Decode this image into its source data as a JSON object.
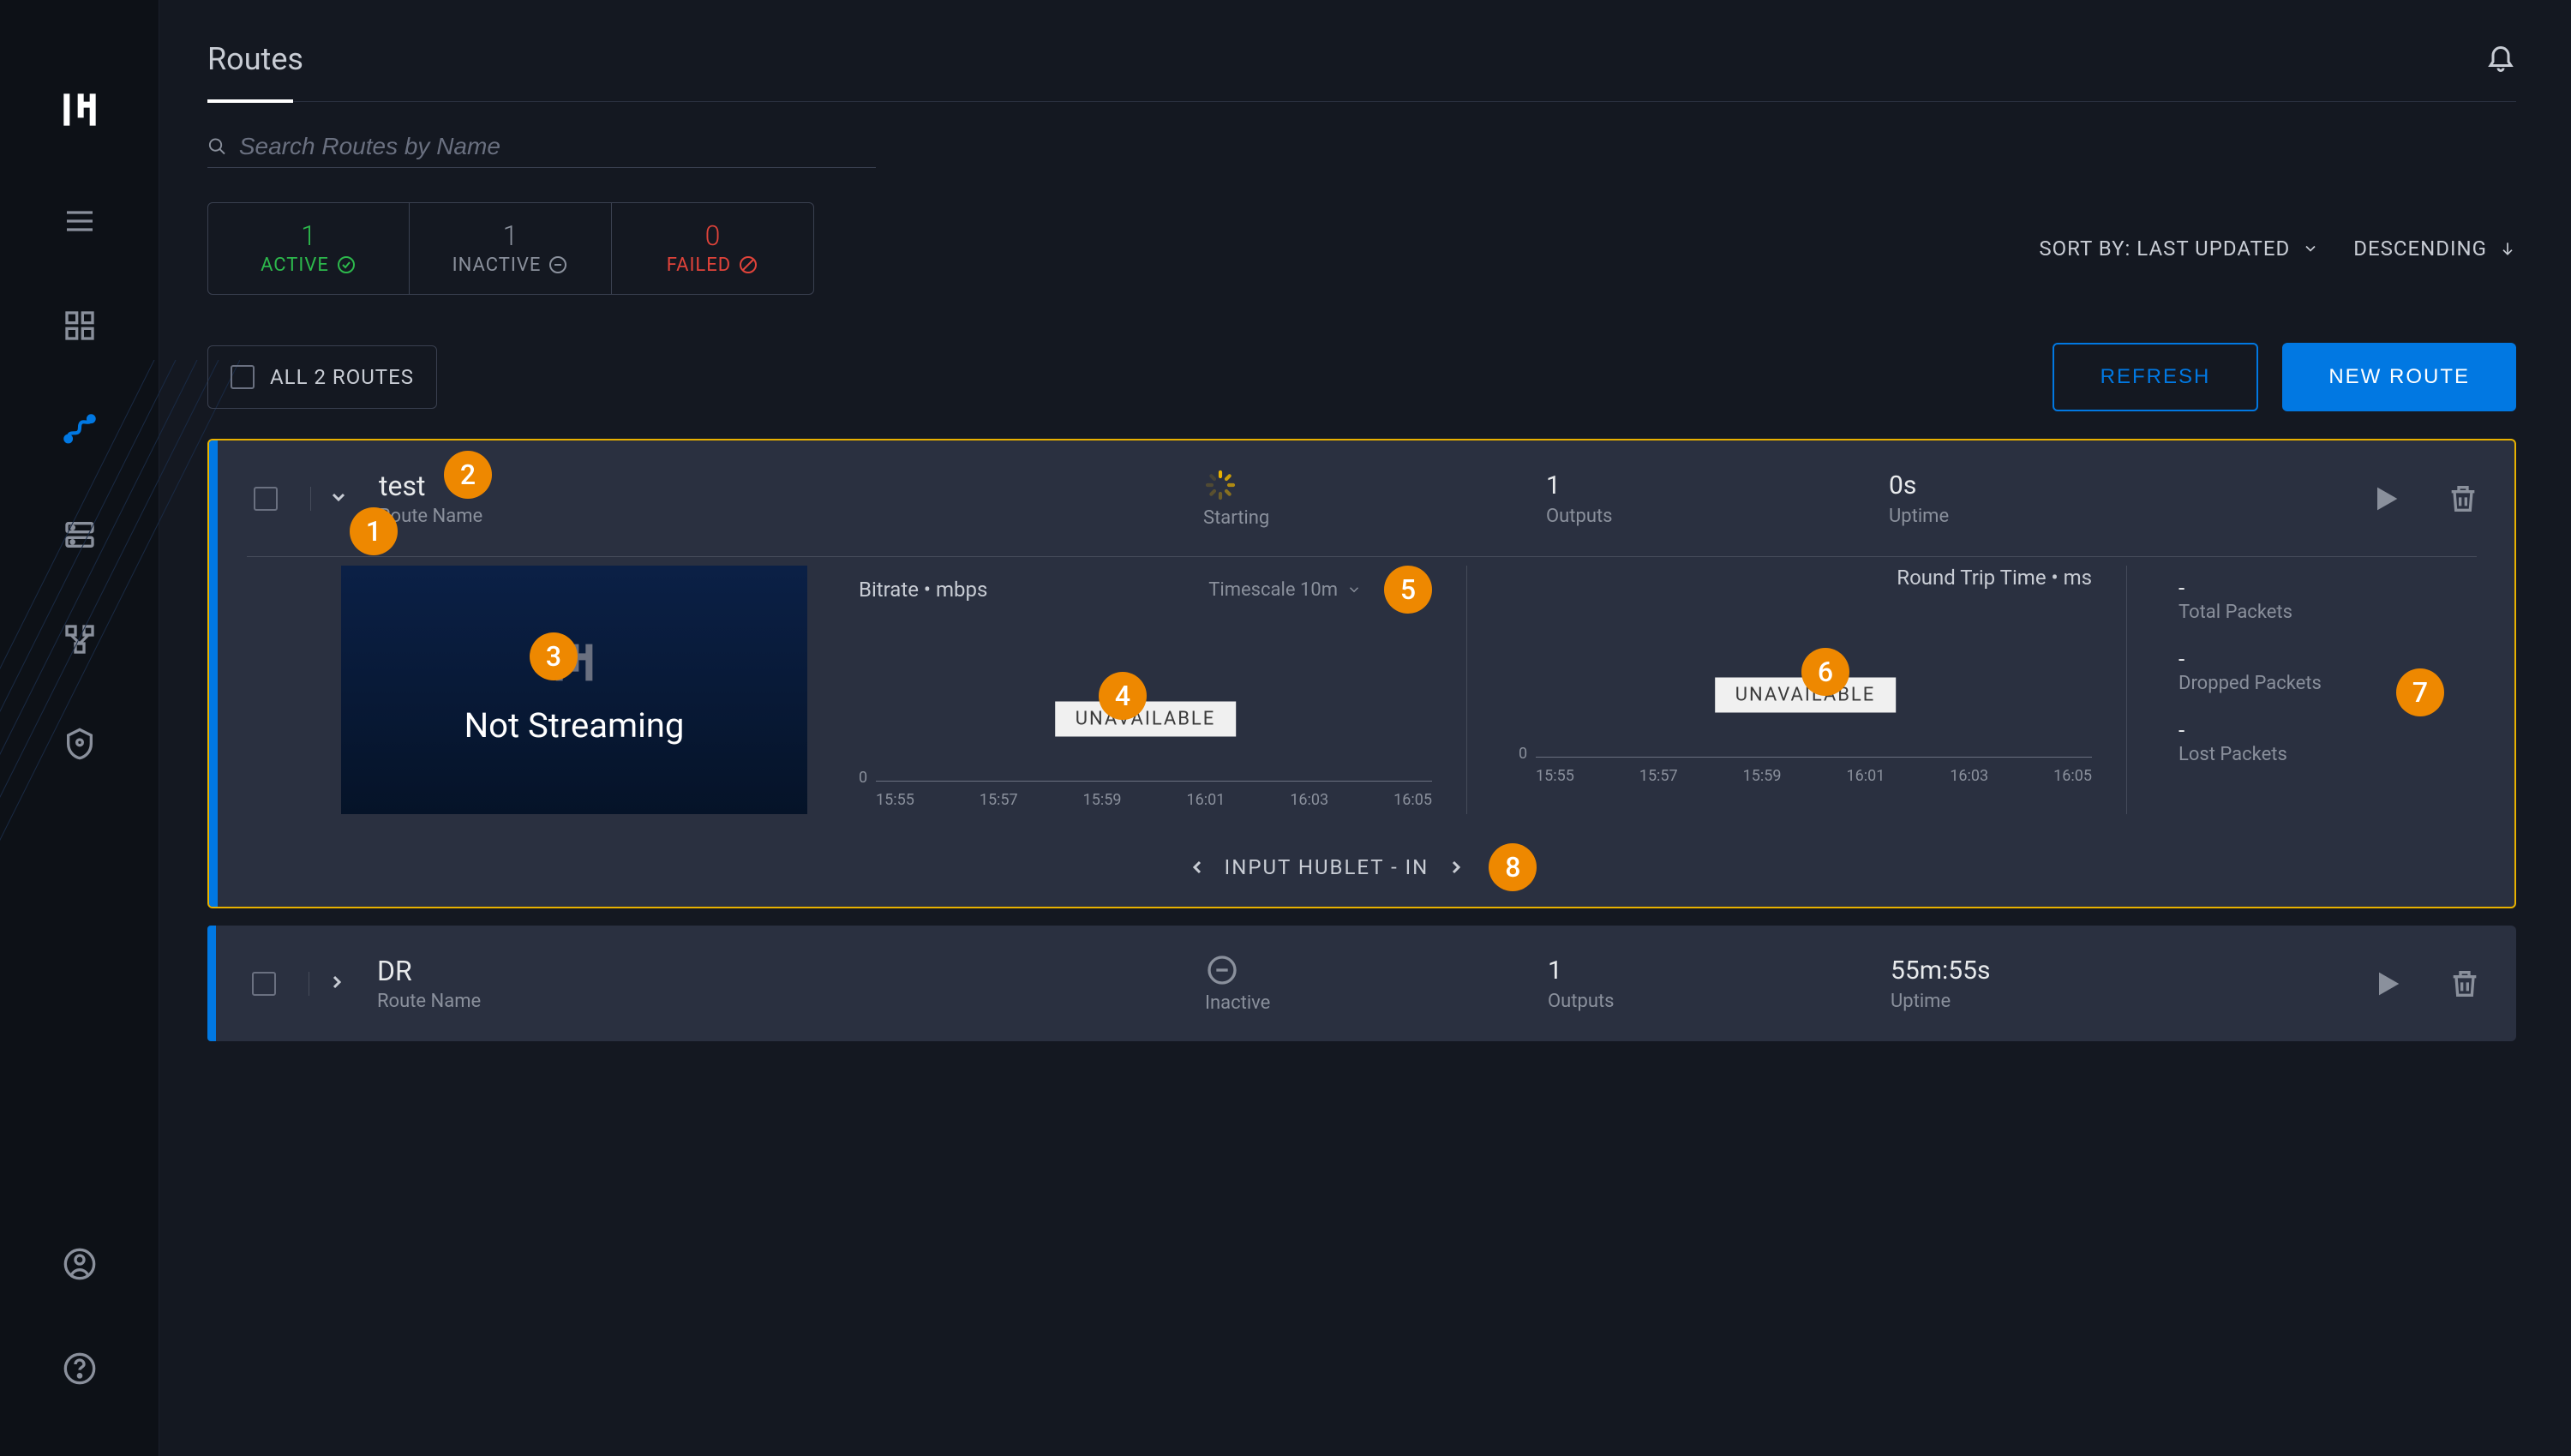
{
  "header": {
    "title": "Routes"
  },
  "search": {
    "placeholder": "Search Routes by Name"
  },
  "status_filters": {
    "active": {
      "count": "1",
      "label": "ACTIVE"
    },
    "inactive": {
      "count": "1",
      "label": "INACTIVE"
    },
    "failed": {
      "count": "0",
      "label": "FAILED"
    }
  },
  "sort": {
    "by_label": "SORT BY: LAST UPDATED",
    "order_label": "DESCENDING"
  },
  "actions": {
    "select_all_label": "ALL 2 ROUTES",
    "refresh": "REFRESH",
    "new_route": "NEW ROUTE"
  },
  "routes": [
    {
      "name": "test",
      "name_sublabel": "Route Name",
      "status_text": "Starting",
      "status_kind": "starting",
      "outputs_value": "1",
      "outputs_label": "Outputs",
      "uptime_value": "0s",
      "uptime_label": "Uptime",
      "preview_text": "Not Streaming",
      "bitrate_title": "Bitrate • mbps",
      "timescale_label": "Timescale 10m",
      "rtt_title": "Round Trip Time • ms",
      "unavailable": "UNAVAILABLE",
      "y_zero": "0",
      "x_ticks": [
        "15:55",
        "15:57",
        "15:59",
        "16:01",
        "16:03",
        "16:05"
      ],
      "packets": {
        "total_value": "-",
        "total_label": "Total Packets",
        "dropped_value": "-",
        "dropped_label": "Dropped Packets",
        "lost_value": "-",
        "lost_label": "Lost Packets"
      },
      "footer_text": "INPUT HUBLET - IN"
    },
    {
      "name": "DR",
      "name_sublabel": "Route Name",
      "status_text": "Inactive",
      "status_kind": "inactive",
      "outputs_value": "1",
      "outputs_label": "Outputs",
      "uptime_value": "55m:55s",
      "uptime_label": "Uptime"
    }
  ],
  "annotations": [
    "1",
    "2",
    "3",
    "4",
    "5",
    "6",
    "7",
    "8"
  ],
  "chart_data": [
    {
      "type": "line",
      "title": "Bitrate • mbps",
      "x_ticks": [
        "15:55",
        "15:57",
        "15:59",
        "16:01",
        "16:03",
        "16:05"
      ],
      "series": [],
      "status": "UNAVAILABLE",
      "ylim": [
        0,
        null
      ],
      "timescale": "10m"
    },
    {
      "type": "line",
      "title": "Round Trip Time • ms",
      "x_ticks": [
        "15:55",
        "15:57",
        "15:59",
        "16:01",
        "16:03",
        "16:05"
      ],
      "series": [],
      "status": "UNAVAILABLE",
      "ylim": [
        0,
        null
      ],
      "timescale": "10m"
    }
  ]
}
